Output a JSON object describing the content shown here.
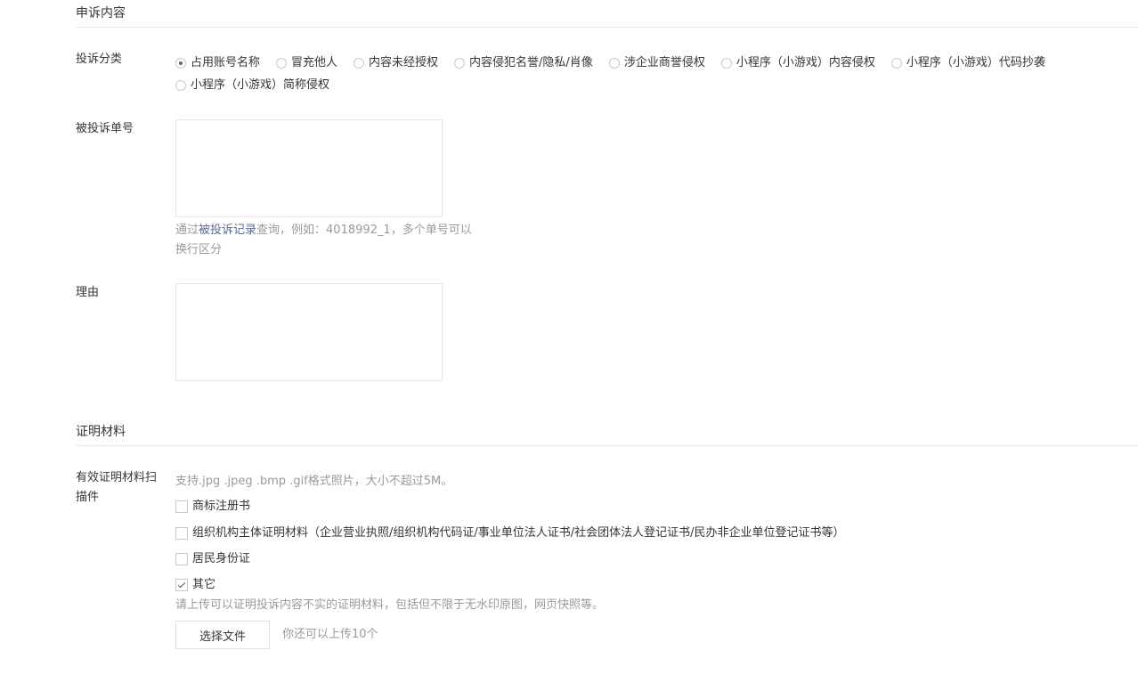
{
  "appeal_section": {
    "title": "申诉内容"
  },
  "category": {
    "label": "投诉分类",
    "selected_index": 0,
    "options": [
      "占用账号名称",
      "冒充他人",
      "内容未经授权",
      "内容侵犯名誉/隐私/肖像",
      "涉企业商誉侵权",
      "小程序（小游戏）内容侵权",
      "小程序（小游戏）代码抄袭",
      "小程序（小游戏）简称侵权"
    ]
  },
  "complaint_number": {
    "label": "被投诉单号",
    "value": "",
    "hint_prefix": "通过",
    "hint_link": "被投诉记录",
    "hint_suffix_line1": "查询，例如：4018992_1，多个单号可以",
    "hint_line2": "换行区分"
  },
  "reason": {
    "label": "理由",
    "value": ""
  },
  "evidence_section": {
    "title": "证明材料"
  },
  "evidence": {
    "label_line1": "有效证明材料扫",
    "label_line2": "描件",
    "format_hint": "支持.jpg .jpeg .bmp .gif格式照片，大小不超过5M。",
    "options": [
      {
        "label": "商标注册书",
        "checked": false
      },
      {
        "label": "组织机构主体证明材料（企业营业执照/组织机构代码证/事业单位法人证书/社会团体法人登记证书/民办非企业单位登记证书等）",
        "checked": false
      },
      {
        "label": "居民身份证",
        "checked": false
      },
      {
        "label": "其它",
        "checked": true
      }
    ],
    "other_hint": "请上传可以证明投诉内容不实的证明材料，包括但不限于无水印原图，网页快照等。",
    "choose_file_label": "选择文件",
    "remaining_text": "你还可以上传10个"
  }
}
